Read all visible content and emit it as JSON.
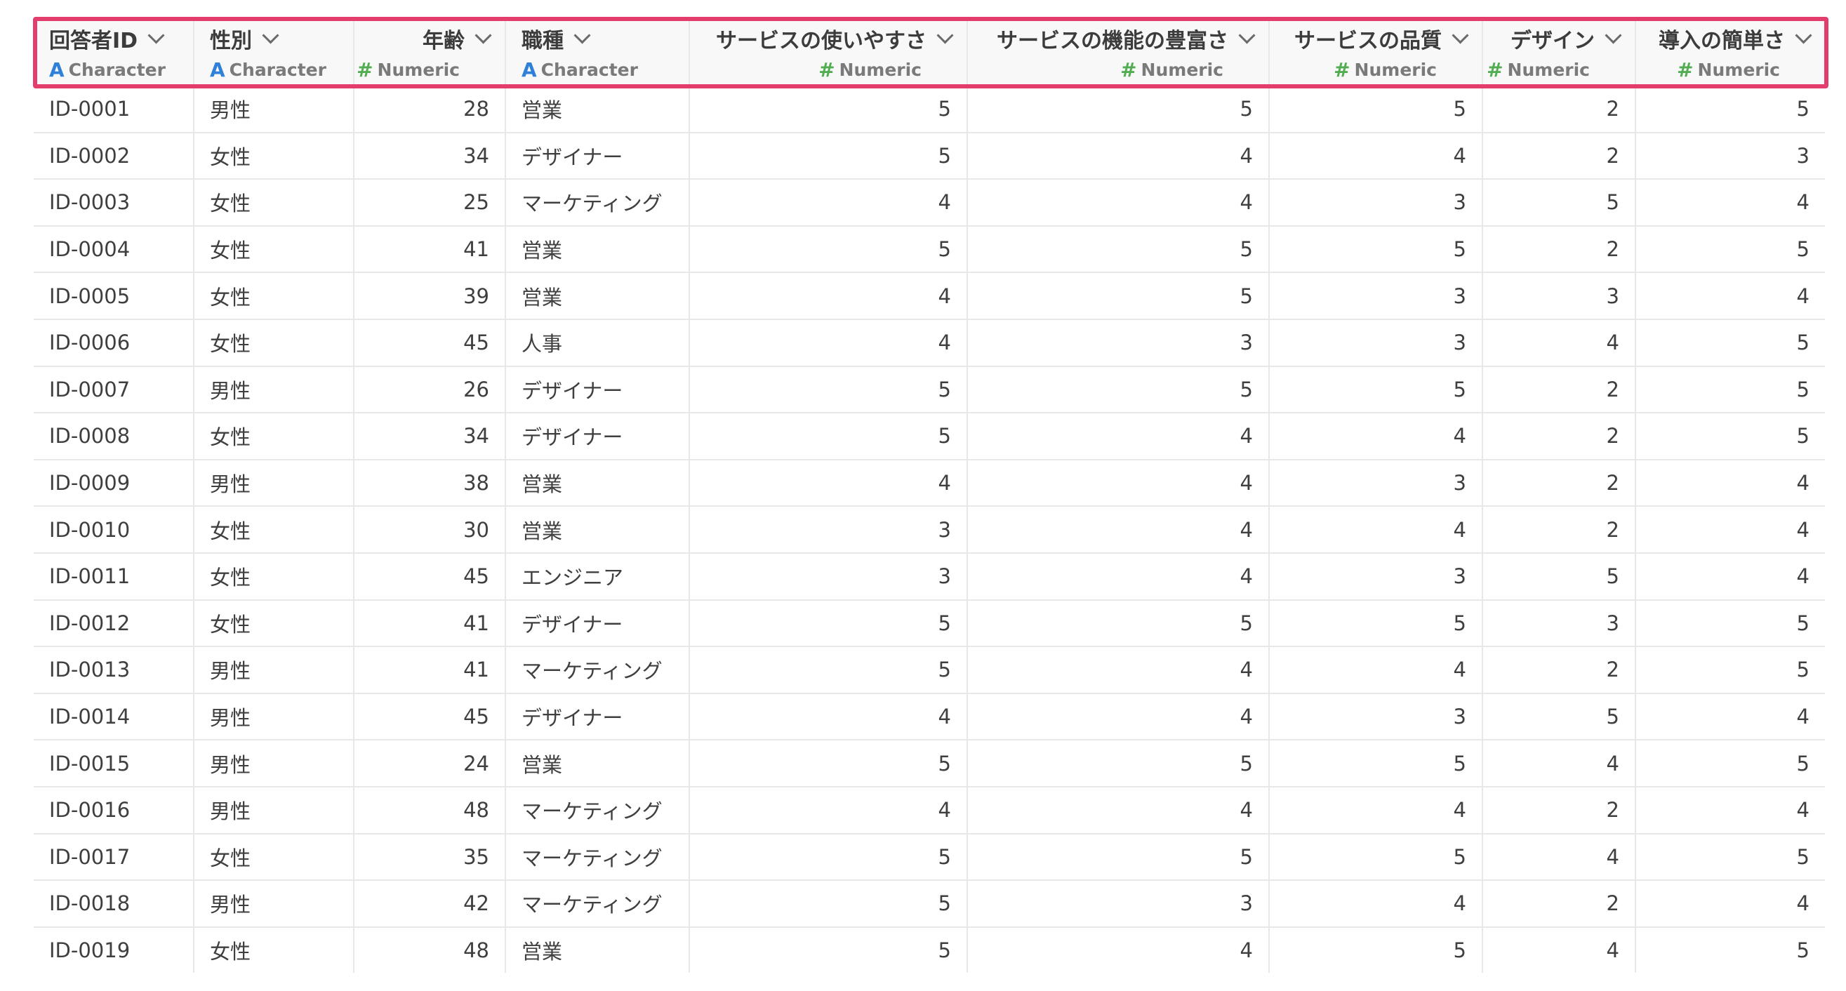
{
  "columns": [
    {
      "name": "回答者ID",
      "type": "Character",
      "kind": "char"
    },
    {
      "name": "性別",
      "type": "Character",
      "kind": "char"
    },
    {
      "name": "年齢",
      "type": "Numeric",
      "kind": "num"
    },
    {
      "name": "職種",
      "type": "Character",
      "kind": "char"
    },
    {
      "name": "サービスの使いやすさ",
      "type": "Numeric",
      "kind": "num"
    },
    {
      "name": "サービスの機能の豊富さ",
      "type": "Numeric",
      "kind": "num"
    },
    {
      "name": "サービスの品質",
      "type": "Numeric",
      "kind": "num"
    },
    {
      "name": "デザイン",
      "type": "Numeric",
      "kind": "num"
    },
    {
      "name": "導入の簡単さ",
      "type": "Numeric",
      "kind": "num"
    }
  ],
  "type_icons": {
    "Character": "A",
    "Numeric": "#"
  },
  "colors": {
    "highlight": "#e23d6d",
    "character_icon": "#2f80d8",
    "numeric_icon": "#52ad52"
  },
  "rows": [
    [
      "ID-0001",
      "男性",
      "28",
      "営業",
      "5",
      "5",
      "5",
      "2",
      "5"
    ],
    [
      "ID-0002",
      "女性",
      "34",
      "デザイナー",
      "5",
      "4",
      "4",
      "2",
      "3"
    ],
    [
      "ID-0003",
      "女性",
      "25",
      "マーケティング",
      "4",
      "4",
      "3",
      "5",
      "4"
    ],
    [
      "ID-0004",
      "女性",
      "41",
      "営業",
      "5",
      "5",
      "5",
      "2",
      "5"
    ],
    [
      "ID-0005",
      "女性",
      "39",
      "営業",
      "4",
      "5",
      "3",
      "3",
      "4"
    ],
    [
      "ID-0006",
      "女性",
      "45",
      "人事",
      "4",
      "3",
      "3",
      "4",
      "5"
    ],
    [
      "ID-0007",
      "男性",
      "26",
      "デザイナー",
      "5",
      "5",
      "5",
      "2",
      "5"
    ],
    [
      "ID-0008",
      "女性",
      "34",
      "デザイナー",
      "5",
      "4",
      "4",
      "2",
      "5"
    ],
    [
      "ID-0009",
      "男性",
      "38",
      "営業",
      "4",
      "4",
      "3",
      "2",
      "4"
    ],
    [
      "ID-0010",
      "女性",
      "30",
      "営業",
      "3",
      "4",
      "4",
      "2",
      "4"
    ],
    [
      "ID-0011",
      "女性",
      "45",
      "エンジニア",
      "3",
      "4",
      "3",
      "5",
      "4"
    ],
    [
      "ID-0012",
      "女性",
      "41",
      "デザイナー",
      "5",
      "5",
      "5",
      "3",
      "5"
    ],
    [
      "ID-0013",
      "男性",
      "41",
      "マーケティング",
      "5",
      "4",
      "4",
      "2",
      "5"
    ],
    [
      "ID-0014",
      "男性",
      "45",
      "デザイナー",
      "4",
      "4",
      "3",
      "5",
      "4"
    ],
    [
      "ID-0015",
      "男性",
      "24",
      "営業",
      "5",
      "5",
      "5",
      "4",
      "5"
    ],
    [
      "ID-0016",
      "男性",
      "48",
      "マーケティング",
      "4",
      "4",
      "4",
      "2",
      "4"
    ],
    [
      "ID-0017",
      "女性",
      "35",
      "マーケティング",
      "5",
      "5",
      "5",
      "4",
      "5"
    ],
    [
      "ID-0018",
      "男性",
      "42",
      "マーケティング",
      "5",
      "3",
      "4",
      "2",
      "4"
    ],
    [
      "ID-0019",
      "女性",
      "48",
      "営業",
      "5",
      "4",
      "5",
      "4",
      "5"
    ]
  ]
}
